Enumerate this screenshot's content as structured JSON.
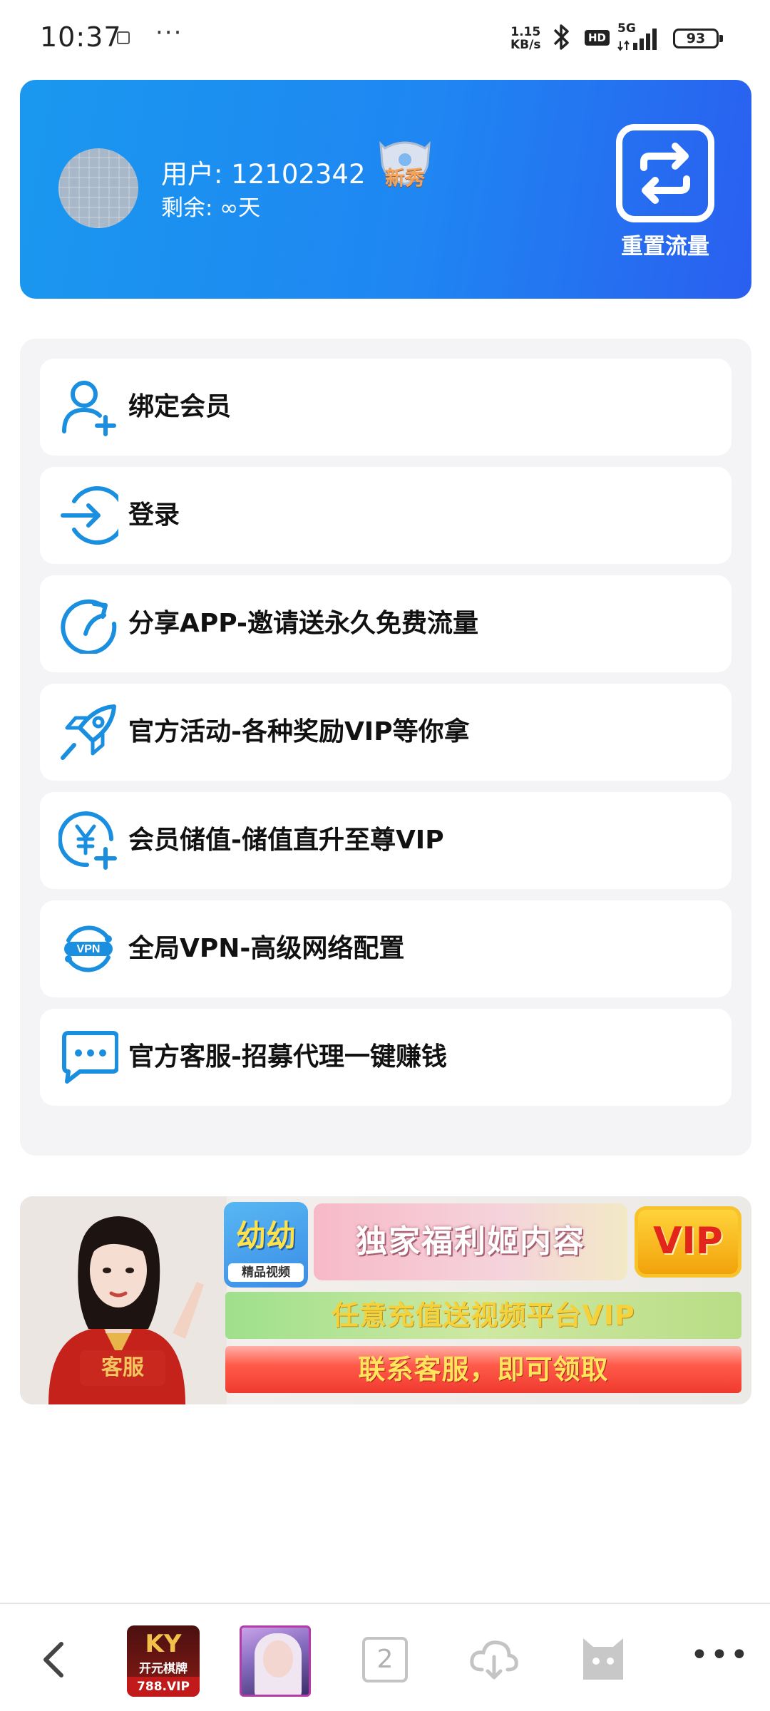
{
  "status_bar": {
    "time": "10:37",
    "more": "···",
    "speed_value": "1.15",
    "speed_unit": "KB/s",
    "hd": "HD",
    "network": "5G",
    "battery": "93"
  },
  "profile": {
    "user_label": "用户: 12102342",
    "remaining_label": "剩余: ∞天",
    "rank_badge": "新秀",
    "reset_button": "重置流量"
  },
  "menu": {
    "items": [
      {
        "label": "绑定会员",
        "icon": "add-user-icon"
      },
      {
        "label": "登录",
        "icon": "login-arrow-icon"
      },
      {
        "label": "分享APP-邀请送永久免费流量",
        "icon": "share-refresh-icon"
      },
      {
        "label": "官方活动-各种奖励VIP等你拿",
        "icon": "rocket-icon"
      },
      {
        "label": "会员储值-储值直升至尊VIP",
        "icon": "yuan-plus-icon"
      },
      {
        "label": "全局VPN-高级网络配置",
        "icon": "vpn-icon"
      },
      {
        "label": "官方客服-招募代理一键赚钱",
        "icon": "chat-bubble-icon"
      }
    ]
  },
  "banner": {
    "kefu_tag": "客服",
    "logo_text": "幼幼",
    "logo_sub": "精品视频",
    "title": "独家福利姬内容",
    "vip": "VIP",
    "line1": "任意充值送视频平台VIP",
    "line2": "联系客服，即可领取"
  },
  "bottom_nav": {
    "app1_logo": "KY",
    "app1_name": "开元棋牌",
    "app1_url": "788.VIP",
    "tab_count": "2"
  },
  "colors": {
    "accent_blue": "#1e8ff0",
    "icon_blue": "#1a8fe0",
    "panel_bg": "#f4f4f6"
  }
}
